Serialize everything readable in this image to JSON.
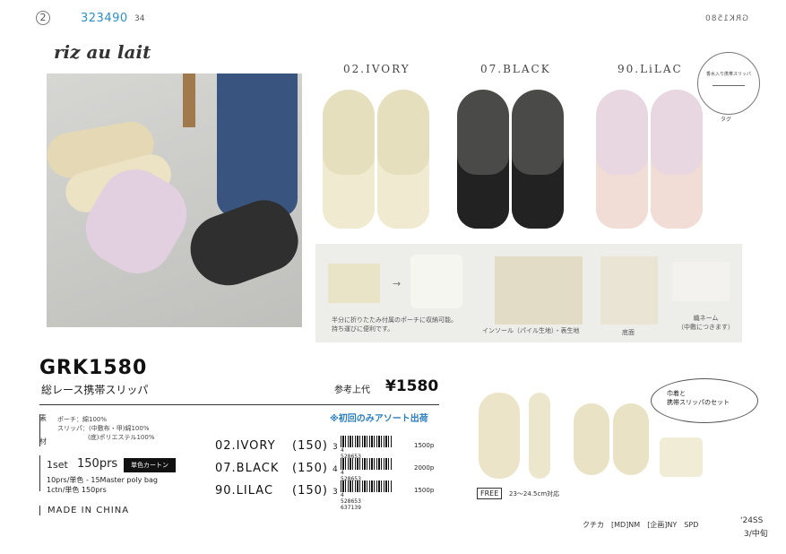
{
  "header": {
    "page_marker": "2",
    "product_code": "323490",
    "page_number": "34",
    "mirrored_code": "GRK1580"
  },
  "brand": "riz au lait",
  "colors": {
    "labels": [
      "02.IVORY",
      "07.BLACK",
      "90.LiLAC"
    ]
  },
  "tag_label": "タグ",
  "tag_text": "香水入り携帯スリッパ",
  "details": {
    "caption_fold": "半分に折りたたみ付属のポーチに収納可能。\n持ち運びに便利です。",
    "caption_insole": "インソール（パイル生地）・表生地",
    "caption_sole": "底面",
    "caption_label": "織ネーム\n（中敷につきます）"
  },
  "product": {
    "title": "GRK1580",
    "subtitle": "総レース携帯スリッパ",
    "price_label": "参考上代",
    "price": "¥1580",
    "note": "※初回のみアソート出荷"
  },
  "material": {
    "label_top": "素",
    "label_bottom": "材",
    "line1": "ポーチ：綿100%",
    "line2": "スリッパ：(中敷布・甲)綿100%",
    "line3": "(底)ポリエステル100%"
  },
  "packing": {
    "set": "1set",
    "prs": "150prs",
    "carton_badge": "単色カートン",
    "line1": "10prs/単色 - 15Master poly bag",
    "line2": "1ctn/単色 150prs"
  },
  "variants": [
    {
      "name": "02.IVORY",
      "qty": "(150)",
      "size_code": "3",
      "jan": "4 528653 637115",
      "pcs": "1500p"
    },
    {
      "name": "07.BLACK",
      "qty": "(150)",
      "size_code": "4",
      "jan": "4 528653 637122",
      "pcs": "2000p"
    },
    {
      "name": "90.LILAC",
      "qty": "(150)",
      "size_code": "3",
      "jan": "4 528653 637139",
      "pcs": "1500p"
    }
  ],
  "made_in": "MADE IN CHINA",
  "bubble_text": "巾着と\n携帯スリッパのセット",
  "size": {
    "badge": "FREE",
    "range": "23～24.5cm対応"
  },
  "footer": {
    "staff": "クチカ　[MD]NM　[企画]NY　SPD",
    "season": "'24SS",
    "ship": "3/中旬"
  }
}
